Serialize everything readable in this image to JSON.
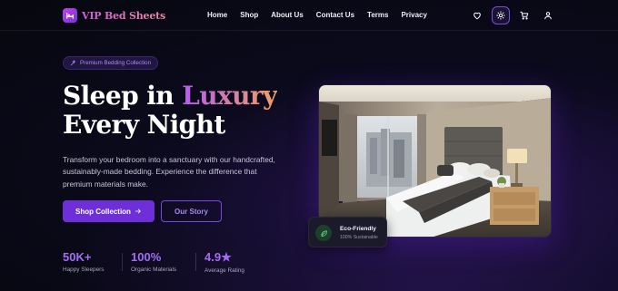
{
  "brand": {
    "name": "VIP Bed Sheets",
    "accent": "#7b2fe0"
  },
  "nav": {
    "items": [
      {
        "label": "Home"
      },
      {
        "label": "Shop"
      },
      {
        "label": "About Us"
      },
      {
        "label": "Contact Us"
      },
      {
        "label": "Terms"
      },
      {
        "label": "Privacy"
      }
    ],
    "icons": [
      "heart-icon",
      "sun-icon",
      "cart-icon",
      "user-icon"
    ]
  },
  "hero": {
    "badge": "Premium Bedding Collection",
    "headline_part1": "Sleep in ",
    "headline_accent": "Luxury",
    "headline_part2": "Every Night",
    "subtext": "Transform your bedroom into a sanctuary with our handcrafted, sustainably-made bedding. Experience the difference that premium materials make.",
    "primary_button": "Shop Collection",
    "secondary_button": "Our Story"
  },
  "stats": [
    {
      "value": "50K+",
      "label": "Happy Sleepers"
    },
    {
      "value": "100%",
      "label": "Organic Materials"
    },
    {
      "value": "4.9★",
      "label": "Average Rating"
    }
  ],
  "eco_card": {
    "title": "Eco-Friendly",
    "subtitle": "100% Sustainable"
  },
  "colors": {
    "background": "#0b0a1c",
    "primary": "#6e2fd8",
    "stat_number": "#a46cf3"
  }
}
